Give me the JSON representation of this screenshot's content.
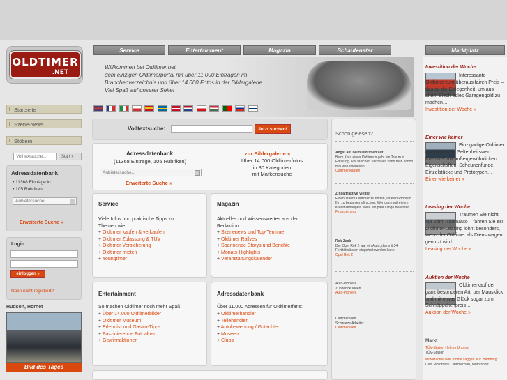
{
  "logo": {
    "text": "OLDTIMER",
    "net": ".NET"
  },
  "nav": {
    "items": [
      "Startseite",
      "Szene-News",
      "Stöbern"
    ]
  },
  "left_search": {
    "placeholder": "Volltextsuche...",
    "button": "Start ›"
  },
  "adressdatenbank": {
    "title": "Adressdatenbank:",
    "items": [
      "11368 Einträge in",
      "105 Rubriken"
    ],
    "select": "Anbietersuche...",
    "link": "Erweiterte Suche »"
  },
  "login": {
    "title": "Login:",
    "button": "einloggen »",
    "link": "Noch nicht registiert?"
  },
  "feature_car": {
    "caption": "Hudson, Hornet",
    "label": "Bild des Tages"
  },
  "tabs": [
    "Service",
    "Entertainment",
    "Magazin",
    "Schaufenster",
    "Marktplatz"
  ],
  "welcome": {
    "lines": [
      "Willkommen bei Oldtimer.net,",
      "dem einzigen Oldtimerportal mit über 11.000 Einträgen im",
      "Branchenverzeichnis und über 14.000 Fotos in der Bildergalerie.",
      "Viel Spaß auf unserer Seite!"
    ]
  },
  "search": {
    "label": "Volltextsuche:",
    "value": "",
    "button": "Jetzt suchen!"
  },
  "adress_box": {
    "title": "Adressdatenbank:",
    "sub": "(11368 Einträge, 105 Rubriken)",
    "select": "Anbietersuche...",
    "link": "Erweiterte Suche »"
  },
  "gallery_box": {
    "link": "zur Bildergalerie »",
    "lines": [
      "Über 14.000 Oldtimerfotos",
      "in 30 Kategorien",
      "mit Markensuche"
    ]
  },
  "service": {
    "title": "Service",
    "intro": [
      "Viele Infos und praktische Tipps zu",
      "Themen wie:"
    ],
    "items": [
      "Oldtimer kaufen & verkaufen",
      "Oldtimer Zulassung & TÜV",
      "Oldtimer Versicherung",
      "Oldtimer mieten",
      "Youngtimer"
    ]
  },
  "magazin": {
    "title": "Magazin",
    "intro": [
      "Aktuelles und Wissenswertes aus der",
      "Redaktion:"
    ],
    "items": [
      "Szenenews und Top-Termine",
      "Oldtimer Rallyes",
      "Spannende Storys und Berichte",
      "Monats-Highlights",
      "Veranstaltungskalender"
    ]
  },
  "entertainment": {
    "title": "Entertainment",
    "intro": [
      "So machen Oldtimer noch mehr Spaß:"
    ],
    "items": [
      "Über 14.000 Oldtimerbilder",
      "Oldtimer Museum",
      "Erlebnis- und Gastro-Tipps",
      "Faszinierende Fotoalben",
      "Gewinnaktionen"
    ]
  },
  "adressdb": {
    "title": "Adressdatenbank",
    "intro": [
      "Über 11.000 Adressen für Oldtimerfans:"
    ],
    "items": [
      "Oldtimerhändler",
      "Teilehändler",
      "Autobewertung / Gutachter",
      "Museen",
      "Clubs"
    ]
  },
  "schon": {
    "title": "Schon gelesen?",
    "items": [
      {
        "h": "Angst auf beim Oldtimerkauf",
        "t": "Beim Kauf eines Oldtimers geht ein Traum in Erfüllung. Vor falschen Vertrauen kann man schon mal was überlesen.",
        "l": "Oldtimer kaufen"
      },
      {
        "h": "Zinsattraktive Vielfalt",
        "t": "Einen Traum-Oldtimer zu finden, ist kein Problem. Ihn zu bezahlen oft schon. Wer dann mit einem Kredit liebäugelt, sollte ein paar Dinge beachten.",
        "l": "Finanzierung"
      },
      {
        "h": "Rek-Zack",
        "t": "Der Opel Rek 2 war ein Auto, das mit 34 Fertitöttslästen eingeholt werden kann.",
        "l": "Opel Rek 2"
      },
      {
        "h": "Auto-Pioniere",
        "t": "Zündende Ideen",
        "l": "Auto-Pioniere"
      },
      {
        "h": "Oldtimerallen",
        "t": "Schwarze Arbeiter",
        "l": "Oldtimerallen"
      }
    ]
  },
  "marktplatz": [
    {
      "title": "Investition der Woche",
      "text": "Interessante Oldtimer zum überaus fairen Preis – das ist die Gelegenheit, um aus altem Blech edles Garagengold zu machen…",
      "link": "Investition der Woche »"
    },
    {
      "title": "Einer wie keiner",
      "text": "Einzigartige Oldtimer mit absolutem Seltenheitswert: Klassiker mit außergewöhnlichen Eigenschaften, Scheunenfunde, Einzelstücke und Prototypen…",
      "link": "Einer wie keiner »"
    },
    {
      "title": "Leasing der Woche",
      "text": "Träumen Sie nicht nur vom Traumauto – fahren Sie es! Oldtimer-Leasing lohnt besonders, wenn der Oldtimer als Dienstwagen genutzt wird…",
      "link": "Leasing der Woche »"
    },
    {
      "title": "Auktion der Woche",
      "text": "Oldtimerkauf der ganz besonderen Art: per Mausklick und mit etwas Glück sogar zum Schnäppchenpreis…",
      "link": "Auktion der Woche »"
    }
  ],
  "markt": {
    "title": "Markt",
    "items": [
      "TÜV-Station Helmm Unbros",
      "TÜV-Station",
      "Motorradfreunde \"home sagger\" e.V. Bamberg",
      "Club Motorrad / Oldtimerclub, Motorsport"
    ]
  },
  "colors": {
    "accent": "#d9480f",
    "brand": "#9a1b12",
    "tab": "#7c7c7c"
  }
}
